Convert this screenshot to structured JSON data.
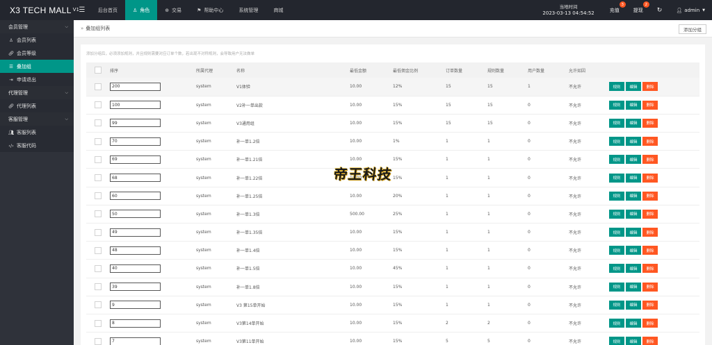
{
  "app": {
    "name": "X3 TECH MALL",
    "version_sup": "V1"
  },
  "topnav": [
    {
      "label": "后台首页",
      "icon": "",
      "active": false
    },
    {
      "label": "角色",
      "icon": "person-icon",
      "active": true
    },
    {
      "label": "交易",
      "icon": "globe-icon",
      "active": false
    },
    {
      "label": "帮助中心",
      "icon": "flag-icon",
      "active": false
    },
    {
      "label": "系统管理",
      "icon": "",
      "active": false
    },
    {
      "label": "商城",
      "icon": "",
      "active": false
    }
  ],
  "clock": {
    "label": "当地时间",
    "value": "2023-03-13 04:54:52"
  },
  "recharge": {
    "label": "充值",
    "badge": "3"
  },
  "withdraw": {
    "label": "提现",
    "badge": "2"
  },
  "user": {
    "name": "admin"
  },
  "sidebar": {
    "groups": [
      {
        "title": "会员管理",
        "items": [
          {
            "label": "会员列表",
            "icon": "user-icon",
            "active": false
          },
          {
            "label": "会员等级",
            "icon": "link-icon",
            "active": false
          },
          {
            "label": "叠加组",
            "icon": "list-icon",
            "active": true
          },
          {
            "label": "申请退出",
            "icon": "exit-icon",
            "active": false
          }
        ]
      },
      {
        "title": "代理管理",
        "items": [
          {
            "label": "代理列表",
            "icon": "link-icon",
            "active": false
          }
        ]
      },
      {
        "title": "客服管理",
        "items": [
          {
            "label": "客服列表",
            "icon": "users-icon",
            "active": false
          },
          {
            "label": "客服代码",
            "icon": "code-icon",
            "active": false
          }
        ]
      }
    ]
  },
  "page": {
    "breadcrumb_sep": "»",
    "breadcrumb": "叠加组列表",
    "add_button": "添加分组",
    "notice": "添加分组后，必须添加规则，并且规则需要对应订单个数，若出现不对称规则，会导致用户无法做单"
  },
  "table": {
    "headers": [
      "",
      "排序",
      "所属代理",
      "名称",
      "最低金额",
      "最低佣金比例",
      "订单数量",
      "规则数量",
      "用户数量",
      "允许如因",
      ""
    ],
    "buttons": {
      "rule": "规则",
      "edit": "编辑",
      "delete": "删除"
    },
    "rows": [
      {
        "sort": "200",
        "agent": "system",
        "name": "V1体验",
        "min_amount": "10.00",
        "min_rate": "12%",
        "orders": "15",
        "rules": "15",
        "users": "1",
        "allow": "不允许"
      },
      {
        "sort": "100",
        "agent": "system",
        "name": "V2补一单出款",
        "min_amount": "10.00",
        "min_rate": "15%",
        "orders": "15",
        "rules": "15",
        "users": "0",
        "allow": "不允许"
      },
      {
        "sort": "99",
        "agent": "system",
        "name": "V3通用组",
        "min_amount": "10.00",
        "min_rate": "15%",
        "orders": "15",
        "rules": "15",
        "users": "0",
        "allow": "不允许"
      },
      {
        "sort": "70",
        "agent": "system",
        "name": "补一单1.2倍",
        "min_amount": "10.00",
        "min_rate": "1%",
        "orders": "1",
        "rules": "1",
        "users": "0",
        "allow": "不允许"
      },
      {
        "sort": "69",
        "agent": "system",
        "name": "补一单1.21倍",
        "min_amount": "10.00",
        "min_rate": "15%",
        "orders": "1",
        "rules": "1",
        "users": "0",
        "allow": "不允许"
      },
      {
        "sort": "68",
        "agent": "system",
        "name": "补一单1.22倍",
        "min_amount": "10.00",
        "min_rate": "15%",
        "orders": "1",
        "rules": "1",
        "users": "0",
        "allow": "不允许"
      },
      {
        "sort": "60",
        "agent": "system",
        "name": "补一单1.25倍",
        "min_amount": "10.00",
        "min_rate": "20%",
        "orders": "1",
        "rules": "1",
        "users": "0",
        "allow": "不允许"
      },
      {
        "sort": "50",
        "agent": "system",
        "name": "补一单1.3倍",
        "min_amount": "500.00",
        "min_rate": "25%",
        "orders": "1",
        "rules": "1",
        "users": "0",
        "allow": "不允许"
      },
      {
        "sort": "49",
        "agent": "system",
        "name": "补一单1.35倍",
        "min_amount": "10.00",
        "min_rate": "15%",
        "orders": "1",
        "rules": "1",
        "users": "0",
        "allow": "不允许"
      },
      {
        "sort": "48",
        "agent": "system",
        "name": "补一单1.4倍",
        "min_amount": "10.00",
        "min_rate": "15%",
        "orders": "1",
        "rules": "1",
        "users": "0",
        "allow": "不允许"
      },
      {
        "sort": "40",
        "agent": "system",
        "name": "补一单1.5倍",
        "min_amount": "10.00",
        "min_rate": "45%",
        "orders": "1",
        "rules": "1",
        "users": "0",
        "allow": "不允许"
      },
      {
        "sort": "39",
        "agent": "system",
        "name": "补一单1.8倍",
        "min_amount": "10.00",
        "min_rate": "15%",
        "orders": "1",
        "rules": "1",
        "users": "0",
        "allow": "不允许"
      },
      {
        "sort": "9",
        "agent": "system",
        "name": "V3 第15单开始",
        "min_amount": "10.00",
        "min_rate": "15%",
        "orders": "1",
        "rules": "1",
        "users": "0",
        "allow": "不允许"
      },
      {
        "sort": "8",
        "agent": "system",
        "name": "V3第14单开始",
        "min_amount": "10.00",
        "min_rate": "15%",
        "orders": "2",
        "rules": "2",
        "users": "0",
        "allow": "不允许"
      },
      {
        "sort": "7",
        "agent": "system",
        "name": "V3第11单开始",
        "min_amount": "10.00",
        "min_rate": "15%",
        "orders": "5",
        "rules": "5",
        "users": "0",
        "allow": "不允许"
      }
    ]
  },
  "watermark": "帝王科技",
  "colors": {
    "accent": "#009688",
    "danger": "#ff5722",
    "topbar": "#23262e",
    "sidebar": "#2f323a"
  }
}
